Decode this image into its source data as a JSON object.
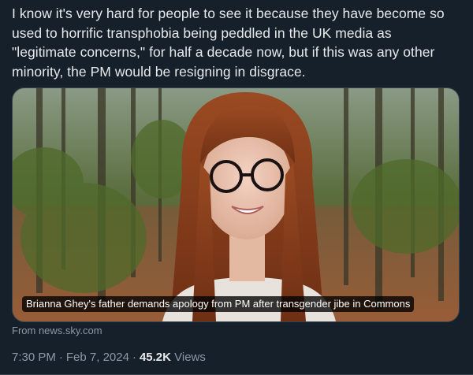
{
  "tweet": {
    "text": "I know it's very hard for people to see it because they have become so used to horrific transphobia being peddled in the UK media as \"legitimate concerns,\" for half a decade now, but if this was any other minority, the PM would be resigning in disgrace."
  },
  "card": {
    "caption": "Brianna Ghey's father demands apology from PM after transgender jibe in Commons",
    "source": "From news.sky.com"
  },
  "meta": {
    "time": "7:30 PM",
    "date": "Feb 7, 2024",
    "views_count": "45.2K",
    "views_label": "Views",
    "separator": "·"
  },
  "colors": {
    "background": "#15202b",
    "text": "#e7e9ea",
    "secondary_text": "#8b98a5",
    "border": "#38444d"
  }
}
